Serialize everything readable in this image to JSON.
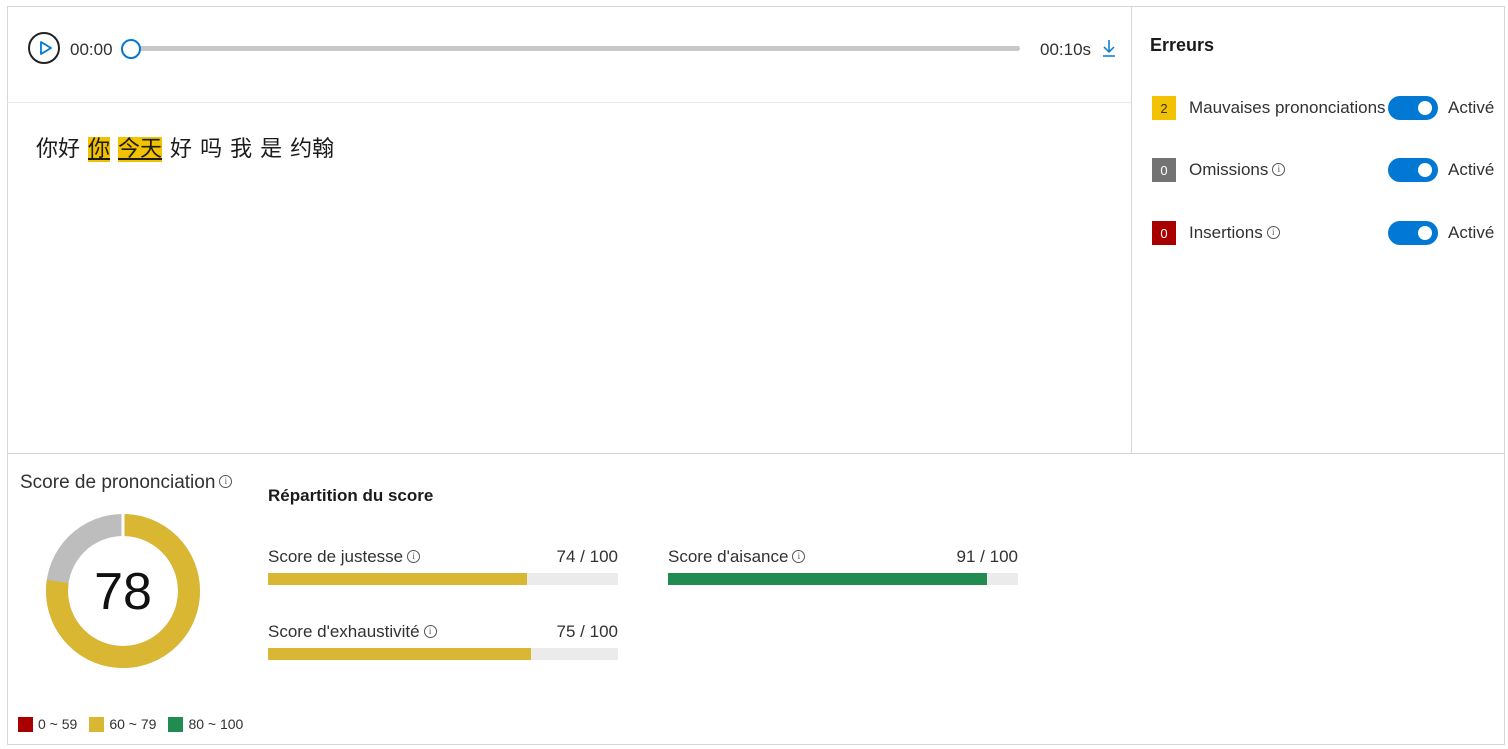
{
  "player": {
    "current_time": "00:00",
    "total_time": "00:10s",
    "progress": 0
  },
  "transcript": {
    "words": [
      {
        "text": "你好",
        "highlighted": false
      },
      {
        "text": "你",
        "highlighted": true
      },
      {
        "text": "今天",
        "highlighted": true
      },
      {
        "text": "好",
        "highlighted": false
      },
      {
        "text": "吗",
        "highlighted": false
      },
      {
        "text": "我",
        "highlighted": false
      },
      {
        "text": "是",
        "highlighted": false
      },
      {
        "text": "约翰",
        "highlighted": false
      }
    ],
    "highlight_color": "#f2c200"
  },
  "errors": {
    "title": "Erreurs",
    "items": [
      {
        "count": "2",
        "label": "Mauvaises prononciations",
        "color": "#f2c200",
        "badge_text_color": "#323130",
        "has_info": false,
        "toggle_label": "Activé",
        "enabled": true
      },
      {
        "count": "0",
        "label": "Omissions",
        "color": "#737373",
        "badge_text_color": "#ffffff",
        "has_info": true,
        "toggle_label": "Activé",
        "enabled": true
      },
      {
        "count": "0",
        "label": "Insertions",
        "color": "#a80000",
        "badge_text_color": "#ffffff",
        "has_info": true,
        "toggle_label": "Activé",
        "enabled": true
      }
    ]
  },
  "score": {
    "title": "Score de prononciation",
    "value": "78",
    "fraction": 0.78,
    "fill_color": "#d9b732",
    "rest_color": "#bdbdbd"
  },
  "breakdown": {
    "title": "Répartition du score",
    "metrics": [
      {
        "label": "Score de justesse",
        "value": "74 / 100",
        "fraction": 0.74,
        "color": "#d9b732"
      },
      {
        "label": "Score d'exhaustivité",
        "value": "75 / 100",
        "fraction": 0.75,
        "color": "#d9b732"
      },
      {
        "label": "Score d'aisance",
        "value": "91 / 100",
        "fraction": 0.91,
        "color": "#218b52"
      }
    ]
  },
  "legend": [
    {
      "label": "0 ~ 59",
      "color": "#a80000"
    },
    {
      "label": "60 ~ 79",
      "color": "#d9b732"
    },
    {
      "label": "80 ~ 100",
      "color": "#218b52"
    }
  ],
  "icons": {
    "play": "play-icon",
    "download": "download-icon",
    "info": "info-icon"
  }
}
